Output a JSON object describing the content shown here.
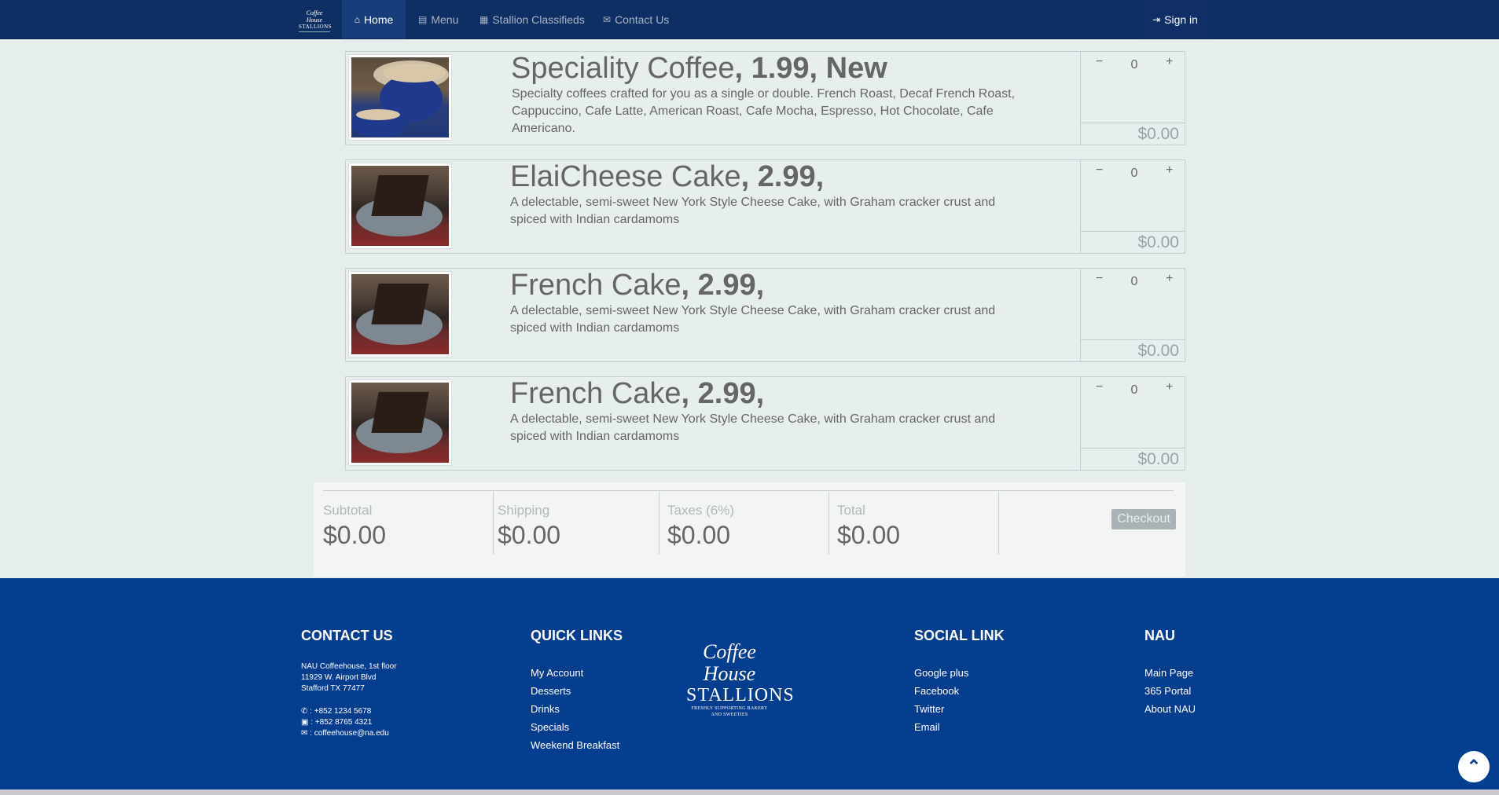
{
  "navbar": {
    "brand": {
      "line1": "Coffee House",
      "line2": "STALLIONS"
    },
    "items": [
      {
        "label": "Home",
        "icon": "home-icon"
      },
      {
        "label": "Menu",
        "icon": "menu-list-icon"
      },
      {
        "label": "Stallion Classifieds",
        "icon": "newspaper-icon"
      },
      {
        "label": "Contact Us",
        "icon": "envelope-icon"
      }
    ],
    "signin": {
      "label": "Sign in",
      "icon": "sign-in-icon"
    }
  },
  "products": [
    {
      "name": "Speciality Coffee",
      "meta": ", 1.99, New",
      "description": "Specialty coffees crafted for you as a single or double. French Roast, Decaf French Roast, Cappuccino, Cafe Latte, American Roast, Cafe Mocha, Espresso, Hot Chocolate, Cafe Americano.",
      "qty": "0",
      "minus": "−",
      "plus": "+",
      "total": "$0.00",
      "image": "coffee"
    },
    {
      "name": "ElaiCheese Cake",
      "meta": ", 2.99,",
      "description": "A delectable, semi-sweet New York Style Cheese Cake, with Graham cracker crust and spiced with Indian cardamoms",
      "qty": "0",
      "minus": "−",
      "plus": "+",
      "total": "$0.00",
      "image": "cake"
    },
    {
      "name": "French Cake",
      "meta": ", 2.99,",
      "description": "A delectable, semi-sweet New York Style Cheese Cake, with Graham cracker crust and spiced with Indian cardamoms",
      "qty": "0",
      "minus": "−",
      "plus": "+",
      "total": "$0.00",
      "image": "cake"
    },
    {
      "name": "French Cake",
      "meta": ", 2.99,",
      "description": "A delectable, semi-sweet New York Style Cheese Cake, with Graham cracker crust and spiced with Indian cardamoms",
      "qty": "0",
      "minus": "−",
      "plus": "+",
      "total": "$0.00",
      "image": "cake"
    }
  ],
  "summary": {
    "subtotal": {
      "label": "Subtotal",
      "value": "$0.00"
    },
    "shipping": {
      "label": "Shipping",
      "value": "$0.00"
    },
    "taxes": {
      "label": "Taxes (6%)",
      "value": "$0.00"
    },
    "total": {
      "label": "Total",
      "value": "$0.00"
    },
    "checkout_label": "Checkout"
  },
  "footer": {
    "contact": {
      "heading": "CONTACT US",
      "address": [
        "NAU Coffeehouse, 1st floor",
        "11929 W. Airport Blvd",
        "Stafford TX 77477"
      ],
      "phone": " : +852 1234 5678",
      "fax": " : +852 8765 4321",
      "email": " : coffeehouse@na.edu"
    },
    "quick_links": {
      "heading": "QUICK LINKS",
      "items": [
        "My Account",
        "Desserts",
        "Drinks",
        "Specials",
        "Weekend Breakfast"
      ]
    },
    "logo": {
      "line1": "Coffee House",
      "line2": "STALLIONS",
      "tagline": "FRESHLY SUPPORTING BAKERY AND SWEETIES"
    },
    "social": {
      "heading": "SOCIAL LINK",
      "items": [
        "Google plus",
        "Facebook",
        "Twitter",
        "Email"
      ]
    },
    "nau": {
      "heading": "NAU",
      "items": [
        "Main Page",
        "365 Portal",
        "About NAU"
      ]
    }
  },
  "colors": {
    "navbar": "#0e2f63",
    "footer": "#053d8f",
    "page": "#e6eded",
    "card": "#e7eeee"
  }
}
